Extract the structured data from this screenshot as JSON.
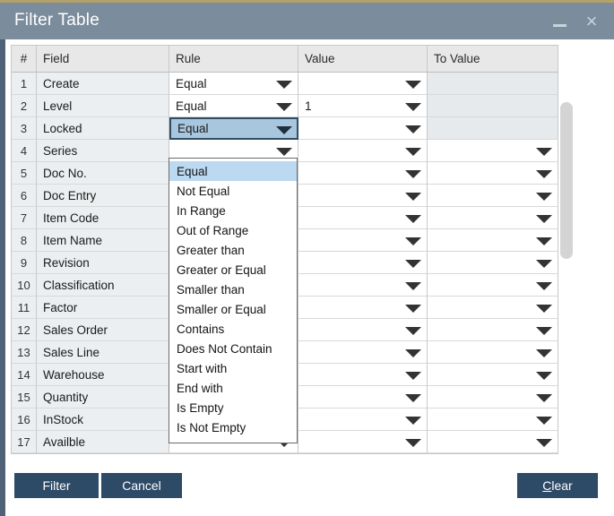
{
  "window": {
    "title": "Filter Table",
    "minimize_label": "_",
    "close_label": "×"
  },
  "grid": {
    "columns": [
      "#",
      "Field",
      "Rule",
      "Value",
      "To Value"
    ],
    "rows": [
      {
        "num": "1",
        "field": "Create",
        "rule": "Equal",
        "value": "",
        "to_value": "",
        "to_value_disabled": true,
        "rule_active": false
      },
      {
        "num": "2",
        "field": "Level",
        "rule": "Equal",
        "value": "1",
        "to_value": "",
        "to_value_disabled": true,
        "rule_active": false
      },
      {
        "num": "3",
        "field": "Locked",
        "rule": "Equal",
        "value": "",
        "to_value": "",
        "to_value_disabled": true,
        "rule_active": true
      },
      {
        "num": "4",
        "field": "Series",
        "rule": "",
        "value": "",
        "to_value": "",
        "to_value_disabled": false,
        "rule_active": false
      },
      {
        "num": "5",
        "field": "Doc No.",
        "rule": "",
        "value": "",
        "to_value": "",
        "to_value_disabled": false,
        "rule_active": false
      },
      {
        "num": "6",
        "field": "Doc Entry",
        "rule": "",
        "value": "",
        "to_value": "",
        "to_value_disabled": false,
        "rule_active": false
      },
      {
        "num": "7",
        "field": "Item Code",
        "rule": "",
        "value": "",
        "to_value": "",
        "to_value_disabled": false,
        "rule_active": false
      },
      {
        "num": "8",
        "field": "Item Name",
        "rule": "",
        "value": "",
        "to_value": "",
        "to_value_disabled": false,
        "rule_active": false
      },
      {
        "num": "9",
        "field": "Revision",
        "rule": "",
        "value": "",
        "to_value": "",
        "to_value_disabled": false,
        "rule_active": false
      },
      {
        "num": "10",
        "field": "Classification",
        "rule": "",
        "value": "",
        "to_value": "",
        "to_value_disabled": false,
        "rule_active": false
      },
      {
        "num": "11",
        "field": "Factor",
        "rule": "",
        "value": "",
        "to_value": "",
        "to_value_disabled": false,
        "rule_active": false
      },
      {
        "num": "12",
        "field": "Sales Order",
        "rule": "",
        "value": "",
        "to_value": "",
        "to_value_disabled": false,
        "rule_active": false
      },
      {
        "num": "13",
        "field": "Sales Line",
        "rule": "",
        "value": "",
        "to_value": "",
        "to_value_disabled": false,
        "rule_active": false
      },
      {
        "num": "14",
        "field": "Warehouse",
        "rule": "",
        "value": "",
        "to_value": "",
        "to_value_disabled": false,
        "rule_active": false
      },
      {
        "num": "15",
        "field": "Quantity",
        "rule": "",
        "value": "",
        "to_value": "",
        "to_value_disabled": false,
        "rule_active": false
      },
      {
        "num": "16",
        "field": "InStock",
        "rule": "",
        "value": "",
        "to_value": "",
        "to_value_disabled": false,
        "rule_active": false
      },
      {
        "num": "17",
        "field": "Availble",
        "rule": "",
        "value": "",
        "to_value": "",
        "to_value_disabled": false,
        "rule_active": false
      }
    ]
  },
  "rule_dropdown": {
    "open": true,
    "selected": "Equal",
    "options": [
      "Equal",
      "Not Equal",
      "In Range",
      "Out of Range",
      "Greater than",
      "Greater or Equal",
      "Smaller than",
      "Smaller or Equal",
      "Contains",
      "Does Not Contain",
      "Start with",
      "End with",
      "Is Empty",
      "Is Not Empty"
    ]
  },
  "footer": {
    "filter_label": "Filter",
    "cancel_label": "Cancel",
    "clear_label_mnemonic": "C",
    "clear_label_rest": "lear"
  },
  "colors": {
    "titlebar": "#7b8c9c",
    "accent_top": "#b2a169",
    "button": "#2d4a66",
    "selection": "#a8c6de",
    "dropdown_selection": "#bcd9f2",
    "disabled_cell": "#e6eaec",
    "window_edge": "#4f6277"
  }
}
